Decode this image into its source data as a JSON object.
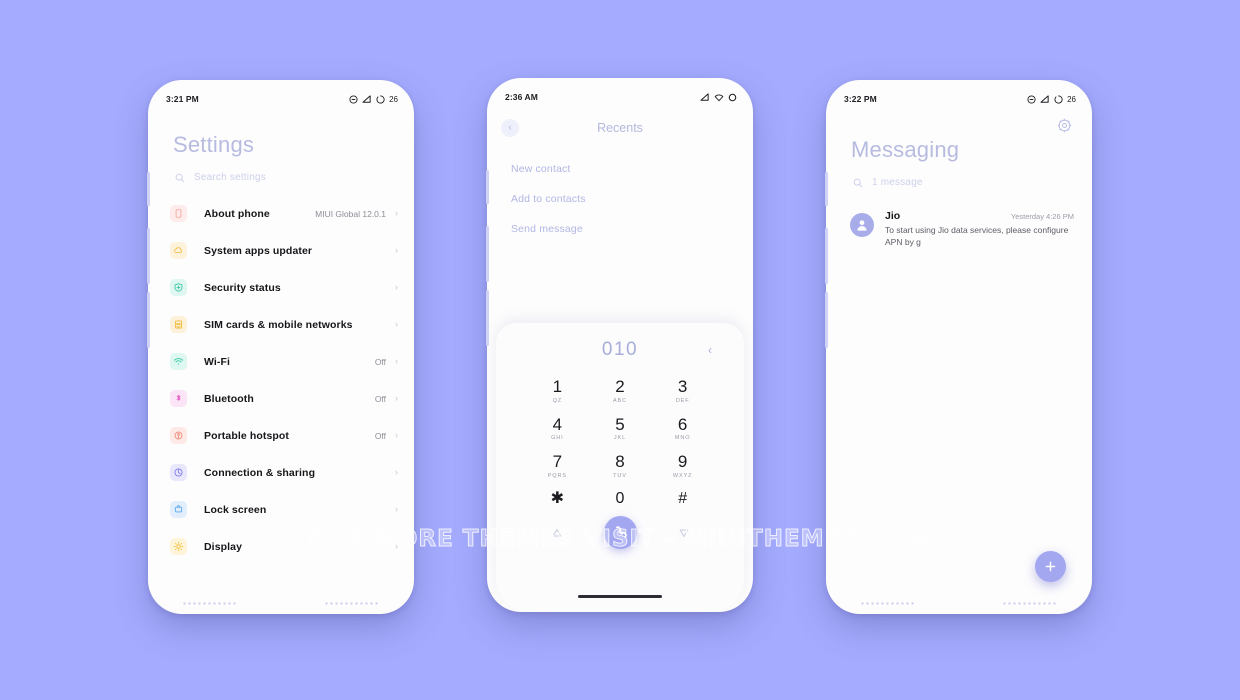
{
  "background_color": "#a5acff",
  "accent_color": "#a3a7ef",
  "watermark": "FOR MORE THEMES VISIT - MIUITHEMEZ.COM",
  "settings_phone": {
    "status_bar": {
      "time": "3:21 PM",
      "battery": "26",
      "icons": [
        "dnd-icon",
        "signal-icon",
        "battery-icon"
      ]
    },
    "title": "Settings",
    "search_placeholder": "Search settings",
    "items": [
      {
        "label": "About phone",
        "value": "MIUI Global 12.0.1",
        "icon": "phone-icon",
        "color": "#f7a9a0",
        "bg": "#fdeceb"
      },
      {
        "label": "System apps updater",
        "value": "",
        "icon": "cloud-icon",
        "color": "#f2c14e",
        "bg": "#fdf3dc"
      },
      {
        "label": "Security status",
        "value": "",
        "icon": "shield-icon",
        "color": "#3fc6a6",
        "bg": "#e0f7f1"
      },
      {
        "label": "SIM cards & mobile networks",
        "value": "",
        "icon": "sim-card-icon",
        "color": "#f0b93b",
        "bg": "#fdf2d9"
      },
      {
        "label": "Wi-Fi",
        "value": "Off",
        "icon": "wifi-icon",
        "color": "#37c9a5",
        "bg": "#def7f0"
      },
      {
        "label": "Bluetooth",
        "value": "Off",
        "icon": "bluetooth-icon",
        "color": "#e75fc3",
        "bg": "#fbe4f5"
      },
      {
        "label": "Portable hotspot",
        "value": "Off",
        "icon": "hotspot-icon",
        "color": "#f08a7c",
        "bg": "#fde9e5"
      },
      {
        "label": "Connection & sharing",
        "value": "",
        "icon": "connection-icon",
        "color": "#7d7ce8",
        "bg": "#e8e7fb"
      },
      {
        "label": "Lock screen",
        "value": "",
        "icon": "lock-screen-icon",
        "color": "#56a9ef",
        "bg": "#e2eefc"
      },
      {
        "label": "Display",
        "value": "",
        "icon": "display-icon",
        "color": "#f2c039",
        "bg": "#fdf4d9"
      }
    ],
    "chevron": "›"
  },
  "dialer_phone": {
    "status_bar": {
      "time": "2:36 AM",
      "battery": "",
      "icons": [
        "signal-icon",
        "wifi-icon",
        "battery-icon"
      ]
    },
    "back_label": "‹",
    "title": "Recents",
    "menu_items": [
      "New contact",
      "Add to contacts",
      "Send message"
    ],
    "dialed_number": "010",
    "backspace_label": "‹",
    "keys": [
      {
        "digit": "1",
        "letters": "QZ"
      },
      {
        "digit": "2",
        "letters": "ABC"
      },
      {
        "digit": "3",
        "letters": "DEF"
      },
      {
        "digit": "4",
        "letters": "GHI"
      },
      {
        "digit": "5",
        "letters": "JKL"
      },
      {
        "digit": "6",
        "letters": "MNO"
      },
      {
        "digit": "7",
        "letters": "PQRS"
      },
      {
        "digit": "8",
        "letters": "TUV"
      },
      {
        "digit": "9",
        "letters": "WXYZ"
      },
      {
        "digit": "✱",
        "letters": ""
      },
      {
        "digit": "0",
        "letters": ""
      },
      {
        "digit": "#",
        "letters": ""
      }
    ],
    "bottom_nav": [
      "contacts-icon",
      "call-button",
      "favorites-icon"
    ]
  },
  "messaging_phone": {
    "status_bar": {
      "time": "3:22 PM",
      "battery": "26",
      "icons": [
        "dnd-icon",
        "signal-icon",
        "battery-icon"
      ]
    },
    "gear_icon": "gear-icon",
    "title": "Messaging",
    "search_placeholder": "1 message",
    "conversations": [
      {
        "name": "Jio",
        "time": "Yesterday 4:26 PM",
        "preview": "To start using Jio data services, please configure APN by g"
      }
    ],
    "fab_icon": "plus-icon"
  }
}
